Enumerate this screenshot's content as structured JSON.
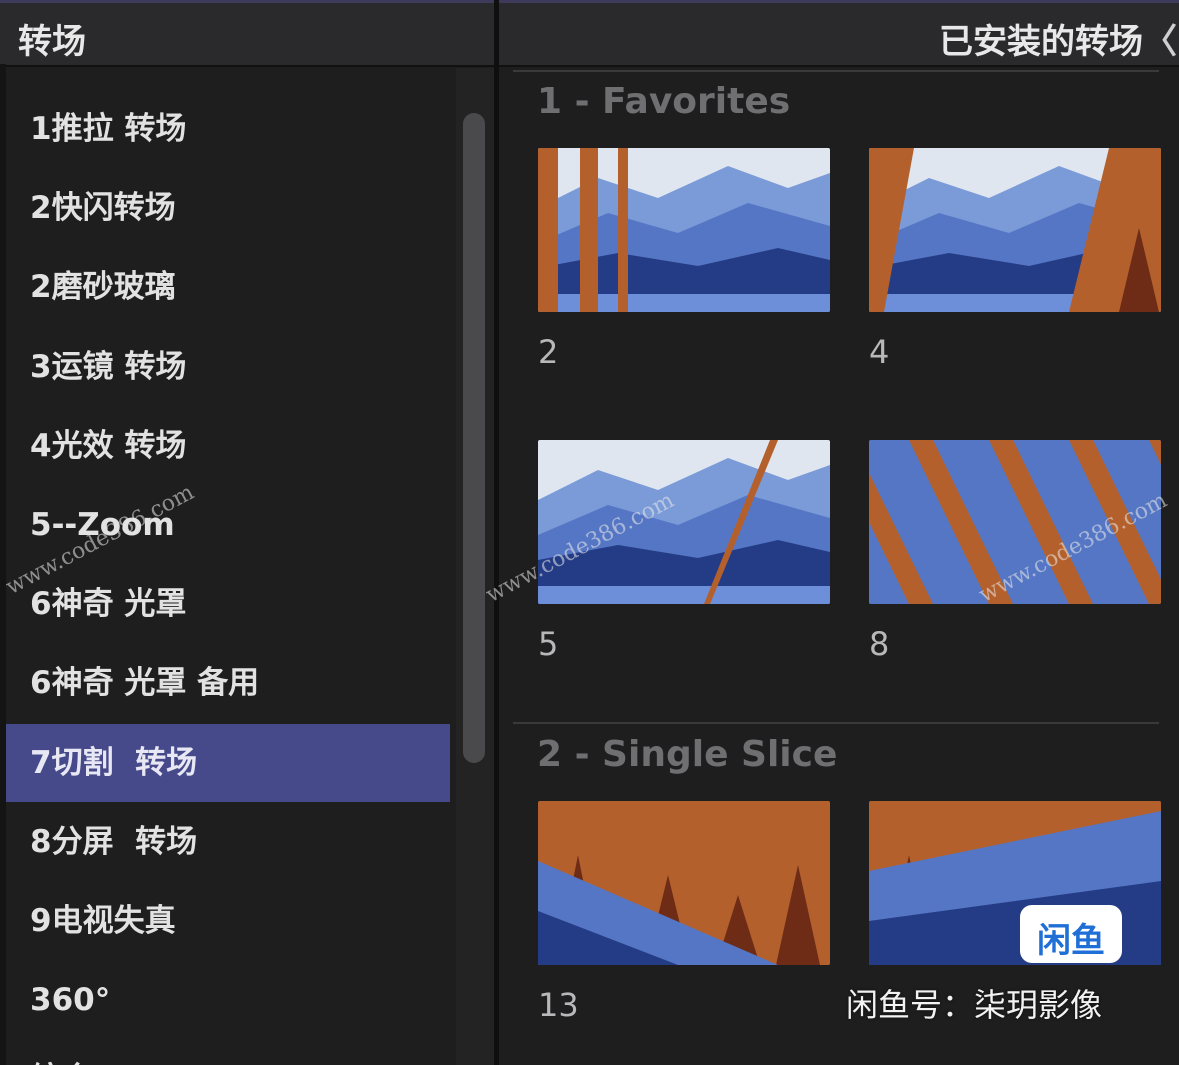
{
  "left_panel": {
    "title": "转场",
    "items": [
      {
        "label": "1推拉 转场"
      },
      {
        "label": "2快闪转场"
      },
      {
        "label": "2磨砂玻璃"
      },
      {
        "label": "3运镜 转场"
      },
      {
        "label": "4光效 转场"
      },
      {
        "label": "5--Zoom"
      },
      {
        "label": "6神奇 光罩"
      },
      {
        "label": "6神奇 光罩 备用"
      },
      {
        "label": "7切割  转场",
        "selected": true
      },
      {
        "label": "8分屏  转场"
      },
      {
        "label": "9电视失真"
      },
      {
        "label": "360°"
      },
      {
        "label": "综合"
      }
    ]
  },
  "right_panel": {
    "title": "已安装的转场",
    "chevron": "〈",
    "sections": [
      {
        "title": "1 - Favorites",
        "items": [
          {
            "label": "2",
            "icon": "transition-thumbnail-icon"
          },
          {
            "label": "4",
            "icon": "transition-thumbnail-icon"
          },
          {
            "label": "5",
            "icon": "transition-thumbnail-icon"
          },
          {
            "label": "8",
            "icon": "transition-thumbnail-icon"
          }
        ]
      },
      {
        "title": "2 - Single Slice",
        "items": [
          {
            "label": "13",
            "icon": "transition-thumbnail-icon"
          },
          {
            "label": "",
            "icon": "transition-thumbnail-icon"
          }
        ]
      }
    ]
  },
  "overlay": {
    "watermarks": [
      "www.code386.com",
      "www.code386.com",
      "www.code386.com"
    ],
    "logo_text": "闲鱼",
    "credit": "闲鱼号：柒玥影像"
  },
  "colors": {
    "selection": "#464a8a",
    "mountain_sky": "#dfe6ef",
    "mountain_light": "#7b9ad8",
    "mountain_mid": "#5576c4",
    "mountain_dark": "#243c86",
    "wood": "#b4602c",
    "wood_dark": "#6e2c16"
  }
}
